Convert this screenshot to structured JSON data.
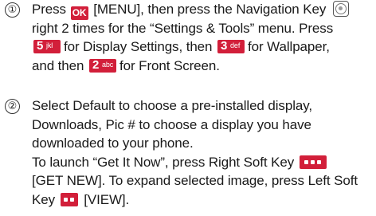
{
  "step1": {
    "number": "①",
    "t1": "Press",
    "ok_label": "OK",
    "t2": "[MENU], then press the Navigation Key",
    "nav_icon": "navigation-key-icon",
    "line2": "right 2 times for the “Settings & Tools” menu. Press",
    "key5": {
      "digit": "5",
      "letters": "jkl"
    },
    "t3": "for Display Settings, then",
    "key3": {
      "digit": "3",
      "letters": "def"
    },
    "t4": "for Wallpaper,",
    "t5": "and then",
    "key2": {
      "digit": "2",
      "letters": "abc"
    },
    "t6": "for Front Screen."
  },
  "step2": {
    "number": "②",
    "line1": "Select Default to choose a pre-installed display,",
    "line2": "Downloads, Pic # to choose a display you have",
    "line3": "downloaded to your phone.",
    "line4": "To launch “Get It Now”, press Right Soft Key",
    "line5": "[GET NEW]. To expand selected image, press Left Soft",
    "line6a": "Key",
    "line6b": "[VIEW]."
  },
  "colors": {
    "key_red": "#d21f3a",
    "text": "#1a1a1a"
  }
}
